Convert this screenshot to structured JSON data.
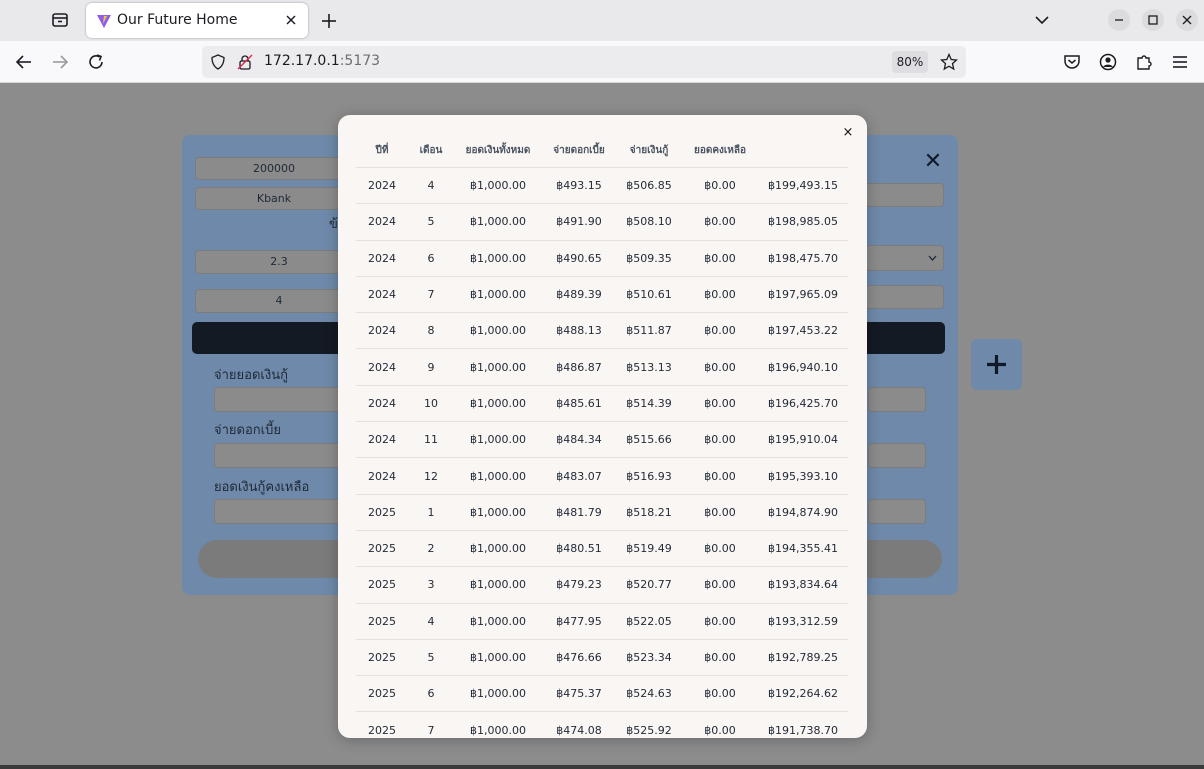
{
  "browser": {
    "tab_title": "Our Future Home",
    "url_host": "172.17.0.1",
    "url_port": ":5173",
    "zoom": "80%"
  },
  "form": {
    "amount": "200000",
    "bank": "Kbank",
    "heading_fragment": "ข้",
    "rate": "2.3",
    "months": "4",
    "label_principal": "จ่ายยอดเงินกู้",
    "label_interest": "จ่ายดอกเบี้ย",
    "label_remaining": "ยอดเงินกู้คงเหลือ",
    "close_symbol": "✕"
  },
  "modal": {
    "close_symbol": "×",
    "headers": [
      "ปีที่",
      "เดือน",
      "ยอดเงินทั้งหมด",
      "จ่ายดอกเบี้ย",
      "จ่ายเงินกู้",
      "ยอดคงเหลือ",
      ""
    ],
    "rows": [
      [
        "2024",
        "4",
        "฿1,000.00",
        "฿493.15",
        "฿506.85",
        "฿0.00",
        "฿199,493.15"
      ],
      [
        "2024",
        "5",
        "฿1,000.00",
        "฿491.90",
        "฿508.10",
        "฿0.00",
        "฿198,985.05"
      ],
      [
        "2024",
        "6",
        "฿1,000.00",
        "฿490.65",
        "฿509.35",
        "฿0.00",
        "฿198,475.70"
      ],
      [
        "2024",
        "7",
        "฿1,000.00",
        "฿489.39",
        "฿510.61",
        "฿0.00",
        "฿197,965.09"
      ],
      [
        "2024",
        "8",
        "฿1,000.00",
        "฿488.13",
        "฿511.87",
        "฿0.00",
        "฿197,453.22"
      ],
      [
        "2024",
        "9",
        "฿1,000.00",
        "฿486.87",
        "฿513.13",
        "฿0.00",
        "฿196,940.10"
      ],
      [
        "2024",
        "10",
        "฿1,000.00",
        "฿485.61",
        "฿514.39",
        "฿0.00",
        "฿196,425.70"
      ],
      [
        "2024",
        "11",
        "฿1,000.00",
        "฿484.34",
        "฿515.66",
        "฿0.00",
        "฿195,910.04"
      ],
      [
        "2024",
        "12",
        "฿1,000.00",
        "฿483.07",
        "฿516.93",
        "฿0.00",
        "฿195,393.10"
      ],
      [
        "2025",
        "1",
        "฿1,000.00",
        "฿481.79",
        "฿518.21",
        "฿0.00",
        "฿194,874.90"
      ],
      [
        "2025",
        "2",
        "฿1,000.00",
        "฿480.51",
        "฿519.49",
        "฿0.00",
        "฿194,355.41"
      ],
      [
        "2025",
        "3",
        "฿1,000.00",
        "฿479.23",
        "฿520.77",
        "฿0.00",
        "฿193,834.64"
      ],
      [
        "2025",
        "4",
        "฿1,000.00",
        "฿477.95",
        "฿522.05",
        "฿0.00",
        "฿193,312.59"
      ],
      [
        "2025",
        "5",
        "฿1,000.00",
        "฿476.66",
        "฿523.34",
        "฿0.00",
        "฿192,789.25"
      ],
      [
        "2025",
        "6",
        "฿1,000.00",
        "฿475.37",
        "฿524.63",
        "฿0.00",
        "฿192,264.62"
      ],
      [
        "2025",
        "7",
        "฿1,000.00",
        "฿474.08",
        "฿525.92",
        "฿0.00",
        "฿191,738.70"
      ]
    ]
  },
  "colors": {
    "modal_bg": "#faf6f4",
    "card_bg": "#6e89aa",
    "overlay": "#8c8c8c",
    "dark_button": "#141a23"
  }
}
